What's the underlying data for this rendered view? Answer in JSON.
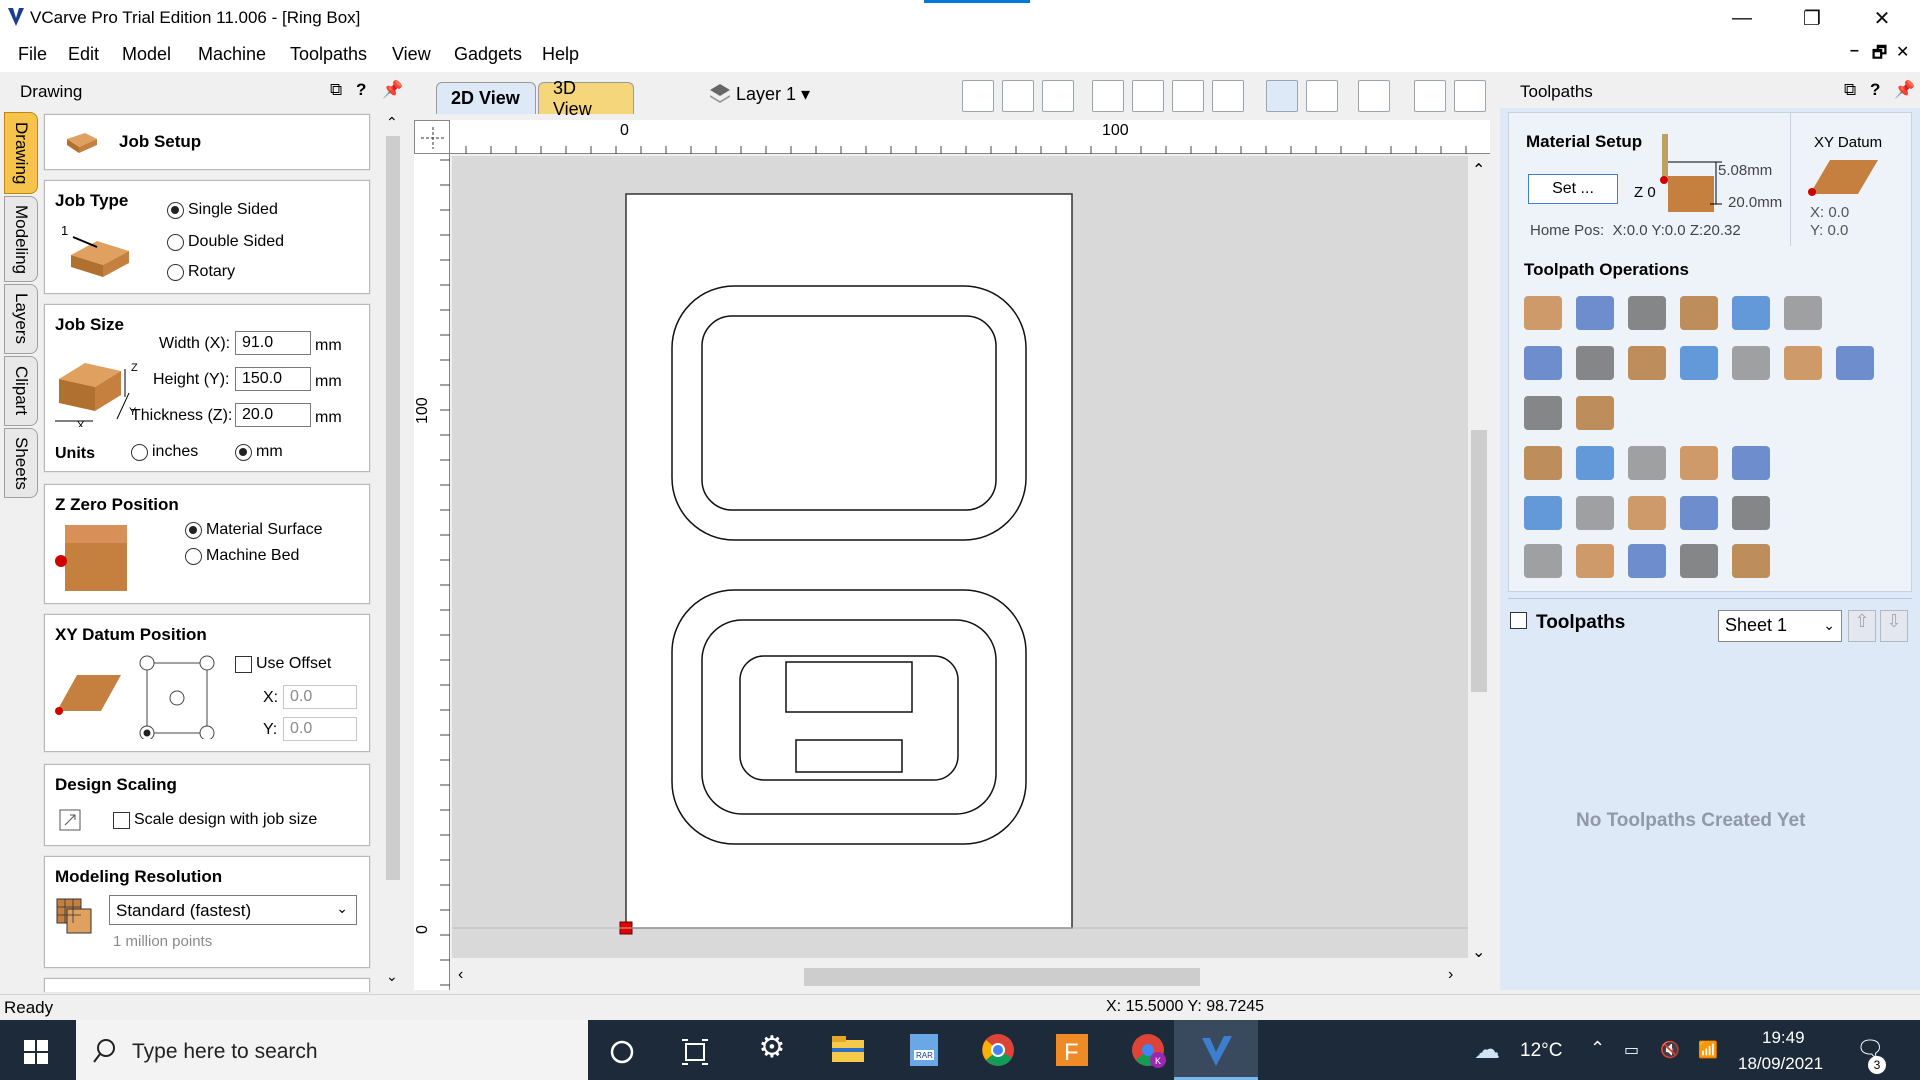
{
  "window": {
    "title": "VCarve Pro Trial Edition 11.006 - [Ring Box]",
    "minimize": "—",
    "maximize": "❐",
    "close": "✕"
  },
  "menu": [
    "File",
    "Edit",
    "Model",
    "Machine",
    "Toolpaths",
    "View",
    "Gadgets",
    "Help"
  ],
  "mdi": {
    "minimize": "–",
    "restore": "🗗",
    "close": "✕"
  },
  "left_panel": {
    "title": "Drawing",
    "tabs": [
      "Drawing",
      "Modeling",
      "Layers",
      "Clipart",
      "Sheets"
    ],
    "job_setup": "Job Setup",
    "job_type": {
      "title": "Job Type",
      "options": [
        "Single Sided",
        "Double Sided",
        "Rotary"
      ],
      "selected": "Single Sided"
    },
    "job_size": {
      "title": "Job Size",
      "width_label": "Width (X):",
      "width_value": "91.0",
      "height_label": "Height (Y):",
      "height_value": "150.0",
      "thickness_label": "Thickness (Z):",
      "thickness_value": "20.0",
      "unit": "mm",
      "units_label": "Units",
      "units_inches": "inches",
      "units_mm": "mm"
    },
    "z_zero": {
      "title": "Z Zero Position",
      "options": [
        "Material Surface",
        "Machine Bed"
      ],
      "selected": "Material Surface"
    },
    "xy_datum": {
      "title": "XY Datum Position",
      "use_offset": "Use Offset",
      "x_label": "X:",
      "x_value": "0.0",
      "y_label": "Y:",
      "y_value": "0.0"
    },
    "design_scaling": {
      "title": "Design Scaling",
      "checkbox": "Scale design with job size"
    },
    "modeling_resolution": {
      "title": "Modeling Resolution",
      "selected": "Standard (fastest)",
      "hint": "1 million points"
    }
  },
  "view": {
    "tab_2d": "2D View",
    "tab_3d": "3D View",
    "layer": "Layer 1",
    "ruler_top": [
      "0",
      "100"
    ],
    "ruler_left": [
      "100",
      "0"
    ]
  },
  "right_panel": {
    "title": "Toolpaths",
    "material_setup": "Material Setup",
    "set_button": "Set ...",
    "z0": "Z 0",
    "depth_top": "5.08mm",
    "depth_total": "20.0mm",
    "xy_datum": "XY Datum",
    "datum_x": "X: 0.0",
    "datum_y": "Y: 0.0",
    "home_pos": "Home Pos:  X:0.0 Y:0.0 Z:20.32",
    "operations_title": "Toolpath Operations",
    "toolpaths_label": "Toolpaths",
    "sheet": "Sheet 1",
    "empty": "No Toolpaths Created Yet"
  },
  "status": {
    "left": "Ready",
    "coords": "X: 15.5000 Y: 98.7245"
  },
  "taskbar": {
    "search_placeholder": "Type here to search",
    "temperature": "12°C",
    "time": "19:49",
    "date": "18/09/2021",
    "notifications": "3"
  },
  "colors": {
    "accent": "#0078d7",
    "panel_blue": "#dde9f7",
    "tab_gold": "#f6c44a",
    "taskbar": "#1c2a3a",
    "origin_red": "#e00000"
  }
}
